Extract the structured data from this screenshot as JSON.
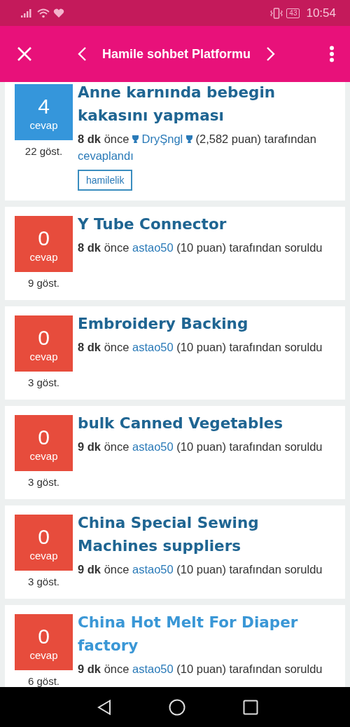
{
  "status_bar": {
    "battery": "43",
    "time": "10:54"
  },
  "header": {
    "title": "Hamile sohbet Platformu"
  },
  "questions": [
    {
      "answers": "4",
      "answers_label": "cevap",
      "answered": true,
      "views": "22 göst.",
      "title": "Anne karnında bebegin kakasını yapması",
      "visited": false,
      "meta": [
        {
          "kind": "time",
          "text": "8 dk"
        },
        {
          "kind": "text",
          "text": "önce"
        },
        {
          "kind": "user",
          "text": "DryŞngl",
          "medal": true
        },
        {
          "kind": "text",
          "text": "(2,582 puan) tarafından"
        },
        {
          "kind": "link",
          "text": "cevaplandı"
        }
      ],
      "tags": [
        "hamilelik"
      ]
    },
    {
      "answers": "0",
      "answers_label": "cevap",
      "answered": false,
      "views": "9 göst.",
      "title": "Y Tube Connector",
      "visited": false,
      "meta": [
        {
          "kind": "time",
          "text": "8 dk"
        },
        {
          "kind": "text",
          "text": "önce"
        },
        {
          "kind": "user",
          "text": "astao50",
          "medal": false
        },
        {
          "kind": "text",
          "text": "(10 puan) tarafından soruldu"
        }
      ]
    },
    {
      "answers": "0",
      "answers_label": "cevap",
      "answered": false,
      "views": "3 göst.",
      "title": "Embroidery Backing",
      "visited": false,
      "meta": [
        {
          "kind": "time",
          "text": "8 dk"
        },
        {
          "kind": "text",
          "text": "önce"
        },
        {
          "kind": "user",
          "text": "astao50",
          "medal": false
        },
        {
          "kind": "text",
          "text": "(10 puan) tarafından soruldu"
        }
      ]
    },
    {
      "answers": "0",
      "answers_label": "cevap",
      "answered": false,
      "views": "3 göst.",
      "title": "bulk Canned Vegetables",
      "visited": false,
      "meta": [
        {
          "kind": "time",
          "text": "9 dk"
        },
        {
          "kind": "text",
          "text": "önce"
        },
        {
          "kind": "user",
          "text": "astao50",
          "medal": false
        },
        {
          "kind": "text",
          "text": "(10 puan) tarafından soruldu"
        }
      ]
    },
    {
      "answers": "0",
      "answers_label": "cevap",
      "answered": false,
      "views": "3 göst.",
      "title": "China Special Sewing Machines suppliers",
      "visited": false,
      "meta": [
        {
          "kind": "time",
          "text": "9 dk"
        },
        {
          "kind": "text",
          "text": "önce"
        },
        {
          "kind": "user",
          "text": "astao50",
          "medal": false
        },
        {
          "kind": "text",
          "text": "(10 puan) tarafından soruldu"
        }
      ]
    },
    {
      "answers": "0",
      "answers_label": "cevap",
      "answered": false,
      "views": "6 göst.",
      "title": "China Hot Melt For Diaper factory",
      "visited": true,
      "meta": [
        {
          "kind": "time",
          "text": "9 dk"
        },
        {
          "kind": "text",
          "text": "önce"
        },
        {
          "kind": "user",
          "text": "astao50",
          "medal": false
        },
        {
          "kind": "text",
          "text": "(10 puan) tarafından soruldu"
        }
      ]
    }
  ]
}
